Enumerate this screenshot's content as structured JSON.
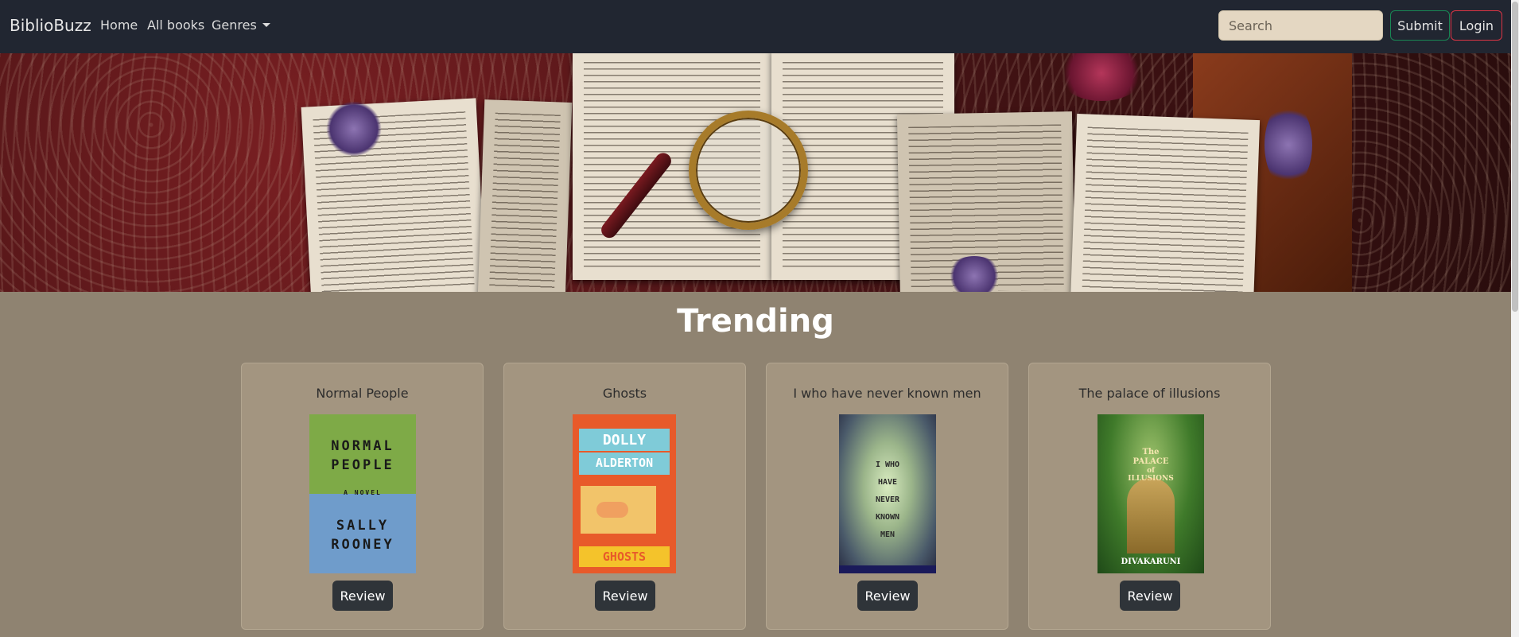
{
  "navbar": {
    "brand": "BiblioBuzz",
    "links": [
      {
        "label": "Home"
      },
      {
        "label": "All books"
      },
      {
        "label": "Genres"
      }
    ],
    "search_placeholder": "Search",
    "submit_label": "Submit",
    "login_label": "Login"
  },
  "trending": {
    "title": "Trending",
    "books": [
      {
        "title": "Normal People",
        "review_label": "Review",
        "cover": {
          "line1": "NORMAL",
          "line2": "PEOPLE",
          "line3": "A NOVEL",
          "line4": "SALLY",
          "line5": "ROONEY"
        }
      },
      {
        "title": "Ghosts",
        "review_label": "Review",
        "cover": {
          "line1": "DOLLY",
          "line2": "ALDERTON",
          "line3": "GHOSTS"
        }
      },
      {
        "title": "I who have never known men",
        "review_label": "Review",
        "cover": {
          "line1": "I WHO",
          "line2": "HAVE",
          "line3": "NEVER",
          "line4": "KNOWN",
          "line5": "MEN"
        }
      },
      {
        "title": "The palace of illusions",
        "review_label": "Review",
        "cover": {
          "line1": "The",
          "line2": "PALACE",
          "line3": "of",
          "line4": "ILLUSIONS",
          "line5": "DIVAKARUNI"
        }
      }
    ]
  },
  "colors": {
    "navbar_bg": "#212631",
    "page_bg": "#8f8371",
    "card_bg": "#a39580",
    "submit_border": "#198754",
    "login_border": "#dc3545",
    "review_btn_bg": "#2f3439"
  },
  "icons": {
    "prev": "chevron-left-icon",
    "next": "chevron-right-icon",
    "dropdown": "caret-down-icon"
  }
}
